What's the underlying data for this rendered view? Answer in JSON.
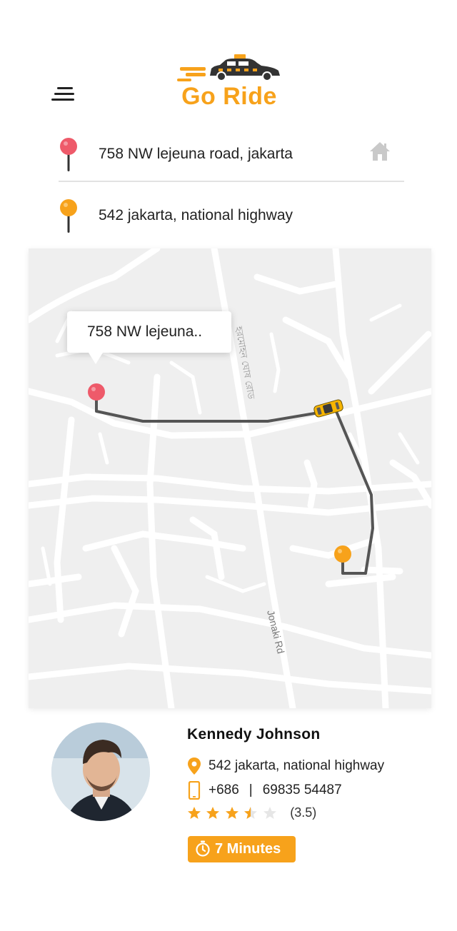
{
  "app": {
    "title": "Go Ride"
  },
  "header": {
    "menu_icon": "hamburger-menu-icon",
    "logo_icon": "taxi-car-icon"
  },
  "route": {
    "pickup": {
      "address": "758 NW lejeuna road, jakarta",
      "icon": "red-location-pin-icon",
      "color": "#EE5A6A"
    },
    "dropoff": {
      "address": "542 jakarta, national highway",
      "icon": "orange-location-pin-icon",
      "color": "#F7A21B"
    },
    "home_icon": "home-icon"
  },
  "map": {
    "tooltip": "758 NW lejeuna..",
    "road_label_main": "Jonaki Rd",
    "road_label_local": "হরমোহন ঘোষ রোড",
    "route_color": "#555555",
    "car_icon": "taxi-car-icon"
  },
  "driver": {
    "name": "Kennedy Johnson",
    "location": "542 jakarta, national highway",
    "phone_code": "+686",
    "phone_separator": "|",
    "phone_number": "69835 54487",
    "rating": 3.5,
    "rating_text": "(3.5)",
    "stars_total": 5,
    "eta": "7 Minutes",
    "accent": "#F7A21B"
  }
}
